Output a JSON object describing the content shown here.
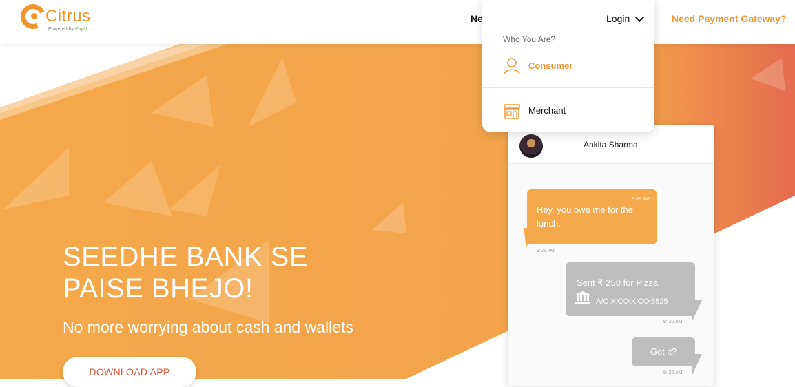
{
  "header": {
    "logo": {
      "name": "Citrus",
      "sub_prefix": "Powered by",
      "sub_brand": "PayU"
    },
    "nav_partial": "Ne",
    "need_gateway": "Need Payment Gateway?"
  },
  "dropdown": {
    "login": "Login",
    "who_you_are": "Who You Are?",
    "options": [
      {
        "label": "Consumer",
        "icon": "user-icon"
      },
      {
        "label": "Merchant",
        "icon": "store-icon"
      }
    ]
  },
  "hero": {
    "title_line1": "SEEDHE BANK SE",
    "title_line2": "PAISE BHEJO!",
    "subtitle": "No more worrying about cash and wallets",
    "cta": "DOWNLOAD APP"
  },
  "chat": {
    "contact": "Ankita Sharma",
    "messages": [
      {
        "text": "Hey, you owe me for the lunch.",
        "time_top": "9:05 AM",
        "time": "9:05 AM"
      },
      {
        "text": "Sent ₹ 250 for Pizza",
        "account": "A/C XXXXXXXX6525",
        "time": "9: 20 AM"
      },
      {
        "text": "Got it?",
        "time": "9: 22 AM"
      }
    ]
  },
  "colors": {
    "brand": "#f0962c",
    "hero": "#f5a94a",
    "accent_red": "#e2522f",
    "bubble_grey": "#bdbdbd"
  }
}
